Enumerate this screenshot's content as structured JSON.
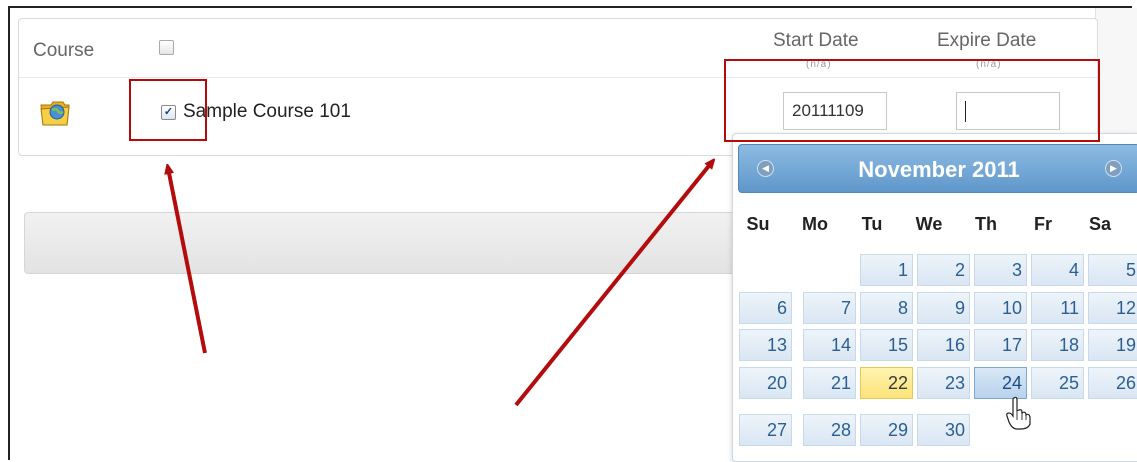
{
  "table": {
    "header_course": "Course",
    "header_start_date": "Start Date",
    "header_start_sub": "(n/a)",
    "header_expire_date": "Expire Date",
    "header_expire_sub": "(n/a)",
    "row": {
      "checked": true,
      "checkmark": "✓",
      "course_name": "Sample Course 101",
      "icon": "course-folder-globe-icon",
      "start_date_value": "20111109",
      "expire_date_value": ""
    }
  },
  "calendar": {
    "title": "November 2011",
    "prev_icon": "chevron-left-icon",
    "next_icon": "chevron-right-icon",
    "prev_glyph": "◀",
    "next_glyph": "▶",
    "weekdays": [
      "Su",
      "Mo",
      "Tu",
      "We",
      "Th",
      "Fr",
      "Sa"
    ],
    "days": [
      "1",
      "2",
      "3",
      "4",
      "5",
      "6",
      "7",
      "8",
      "9",
      "10",
      "11",
      "12",
      "13",
      "14",
      "15",
      "16",
      "17",
      "18",
      "19",
      "20",
      "21",
      "22",
      "23",
      "24",
      "25",
      "26",
      "27",
      "28",
      "29",
      "30"
    ],
    "today": "22",
    "hovered": "24"
  },
  "annotation_color": "#b40c0c",
  "highlight_color": "#fbe27a"
}
